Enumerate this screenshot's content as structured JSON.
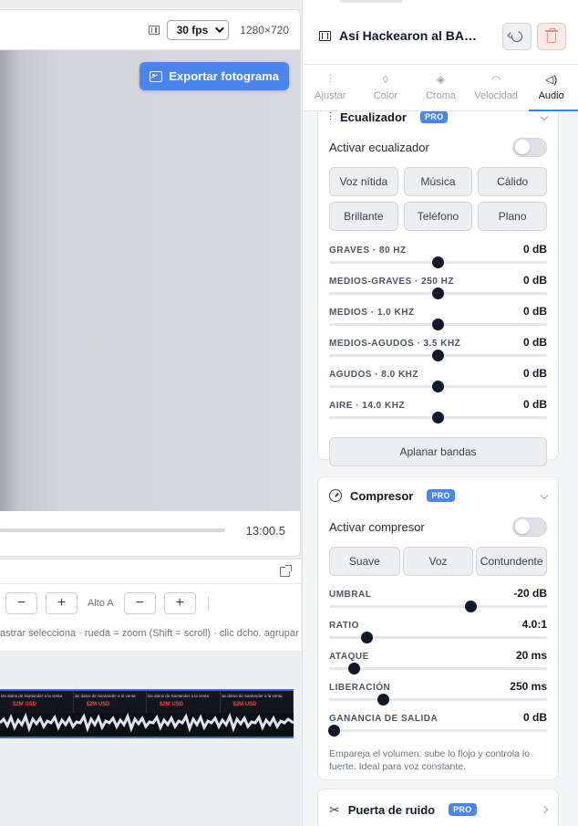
{
  "preview": {
    "fps_label": "30 fps",
    "resolution": "1280×720",
    "export_label": "Exportar fotograma",
    "time": "13:00.5"
  },
  "timeline": {
    "minus_label": "−",
    "plus_label": "+",
    "alto_label": "Alto A",
    "hint": "astrar selecciona · rueda = zoom (Shift = scroll) · clic dcho. agrupar",
    "frame_caption": "las datos de Santander a la venta",
    "frame_tag": "$2M USD"
  },
  "panel": {
    "clip_title": "Así Hackearon al BANCO SANTANDER",
    "tabs": [
      {
        "label": "Ajustar",
        "icon": "sliders-icon"
      },
      {
        "label": "Color",
        "icon": "droplet-icon"
      },
      {
        "label": "Croma",
        "icon": "layers-icon"
      },
      {
        "label": "Velocidad",
        "icon": "speedometer-icon"
      },
      {
        "label": "Audio",
        "icon": "speaker-icon"
      }
    ],
    "active_tab": "Audio"
  },
  "equalizer": {
    "title": "Ecualizador",
    "pro_badge": "PRO",
    "toggle_label": "Activar ecualizador",
    "enabled": false,
    "presets": [
      "Voz nítida",
      "Música",
      "Cálido",
      "Brillante",
      "Teléfono",
      "Plano"
    ],
    "bands": [
      {
        "label": "GRAVES · 80 HZ",
        "value": "0 dB",
        "level": 0.5
      },
      {
        "label": "MEDIOS-GRAVES · 250 HZ",
        "value": "0 dB",
        "level": 0.5
      },
      {
        "label": "MEDIOS · 1.0 KHZ",
        "value": "0 dB",
        "level": 0.5
      },
      {
        "label": "MEDIOS-AGUDOS · 3.5 KHZ",
        "value": "0 dB",
        "level": 0.5
      },
      {
        "label": "AGUDOS · 8.0 KHZ",
        "value": "0 dB",
        "level": 0.5
      },
      {
        "label": "AIRE · 14.0 KHZ",
        "value": "0 dB",
        "level": 0.5
      }
    ],
    "flatten_label": "Aplanar bandas"
  },
  "compressor": {
    "title": "Compresor",
    "pro_badge": "PRO",
    "toggle_label": "Activar compresor",
    "enabled": false,
    "presets": [
      "Suave",
      "Voz",
      "Contundente"
    ],
    "params": [
      {
        "label": "UMBRAL",
        "value": "-20 dB",
        "level": 0.65
      },
      {
        "label": "RATIO",
        "value": "4.0:1",
        "level": 0.175
      },
      {
        "label": "ATAQUE",
        "value": "20 ms",
        "level": 0.115
      },
      {
        "label": "LIBERACIÓN",
        "value": "250 ms",
        "level": 0.25
      },
      {
        "label": "GANANCIA DE SALIDA",
        "value": "0 dB",
        "level": 0.025
      }
    ],
    "hint": "Empareja el volumen: sube lo flojo y controla lo fuerte. Ideal para voz constante."
  },
  "noise_gate": {
    "title": "Puerta de ruido",
    "pro_badge": "PRO"
  },
  "colors": {
    "accent": "#4c84ee",
    "danger_bg": "#fde8e8",
    "thumb": "#111827"
  }
}
